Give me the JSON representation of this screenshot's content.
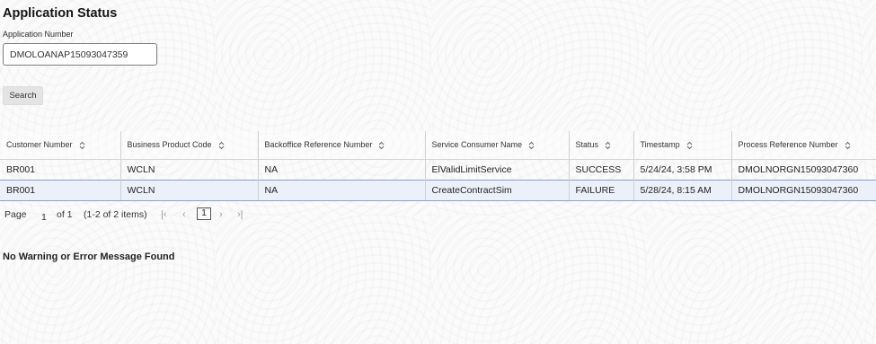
{
  "page": {
    "title": "Application Status",
    "field_label": "Application Number",
    "application_number": "DMOLOANAP15093047359",
    "search_label": "Search"
  },
  "table": {
    "columns": [
      "Customer Number",
      "Business Product Code",
      "Backoffice Reference Number",
      "Service Consumer Name",
      "Status",
      "Timestamp",
      "Process Reference Number"
    ],
    "rows": [
      [
        "BR001",
        "WCLN",
        "NA",
        "ElValidLimitService",
        "SUCCESS",
        "5/24/24, 3:58 PM",
        "DMOLNORGN15093047360"
      ],
      [
        "BR001",
        "WCLN",
        "NA",
        "CreateContractSim",
        "FAILURE",
        "5/28/24, 8:15 AM",
        "DMOLNORGN15093047360"
      ]
    ],
    "selected_row": 1
  },
  "pagination": {
    "page_label": "Page",
    "page_value": "1",
    "of_label": "of 1",
    "items_label": "(1-2 of 2 items)",
    "current_page": "1",
    "first_icon": "first-page-icon",
    "prev_icon": "previous-page-icon",
    "next_icon": "next-page-icon",
    "last_icon": "last-page-icon"
  },
  "message": "No Warning or Error Message Found"
}
